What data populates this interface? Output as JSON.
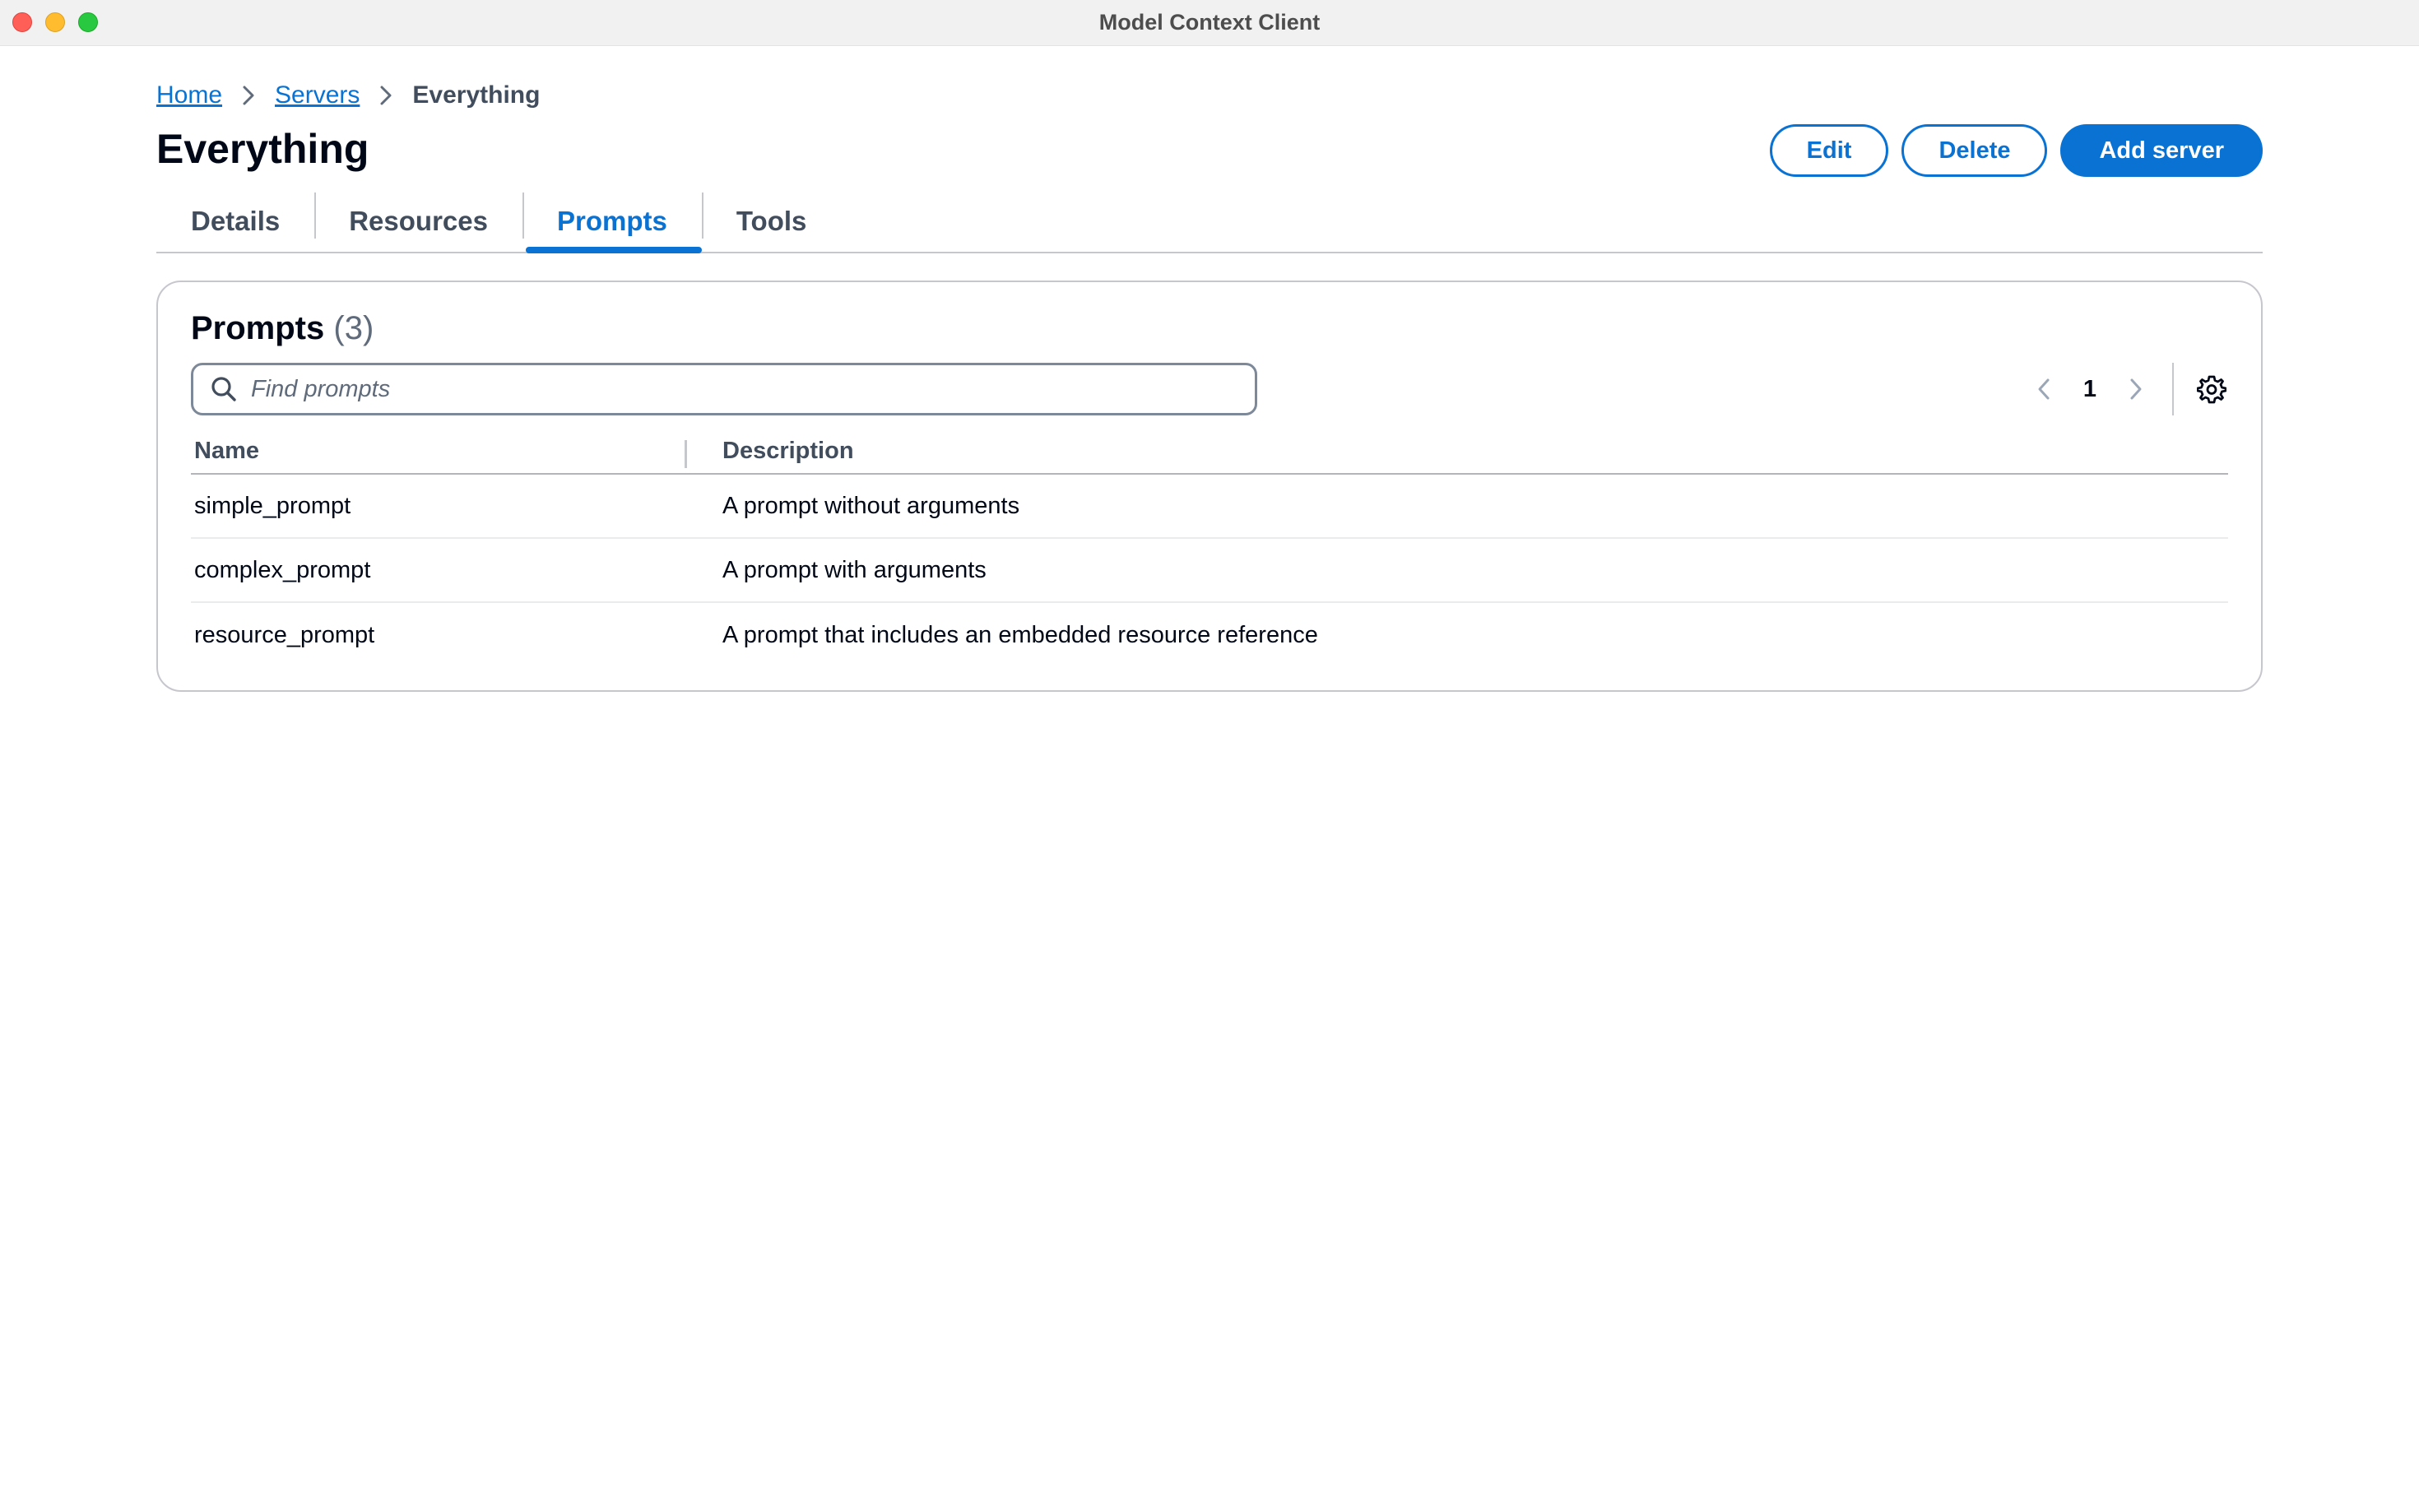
{
  "window": {
    "title": "Model Context Client"
  },
  "breadcrumb": {
    "items": [
      {
        "label": "Home"
      },
      {
        "label": "Servers"
      }
    ],
    "current": "Everything"
  },
  "header": {
    "title": "Everything",
    "actions": {
      "edit": "Edit",
      "delete": "Delete",
      "add": "Add server"
    }
  },
  "tabs": [
    {
      "label": "Details"
    },
    {
      "label": "Resources"
    },
    {
      "label": "Prompts",
      "active": true
    },
    {
      "label": "Tools"
    }
  ],
  "prompts": {
    "title": "Prompts",
    "count": "(3)",
    "search": {
      "placeholder": "Find prompts",
      "value": ""
    },
    "pagination": {
      "current_page": "1"
    },
    "columns": {
      "name": "Name",
      "description": "Description"
    },
    "rows": [
      {
        "name": "simple_prompt",
        "description": "A prompt without arguments"
      },
      {
        "name": "complex_prompt",
        "description": "A prompt with arguments"
      },
      {
        "name": "resource_prompt",
        "description": "A prompt that includes an embedded resource reference"
      }
    ]
  },
  "colors": {
    "accent": "#0972d3",
    "text": "#000716",
    "muted": "#414d5c",
    "border": "#c6c6cd"
  },
  "icons": [
    "chevron-right-icon",
    "search-icon",
    "chevron-left-icon",
    "settings-gear-icon"
  ]
}
